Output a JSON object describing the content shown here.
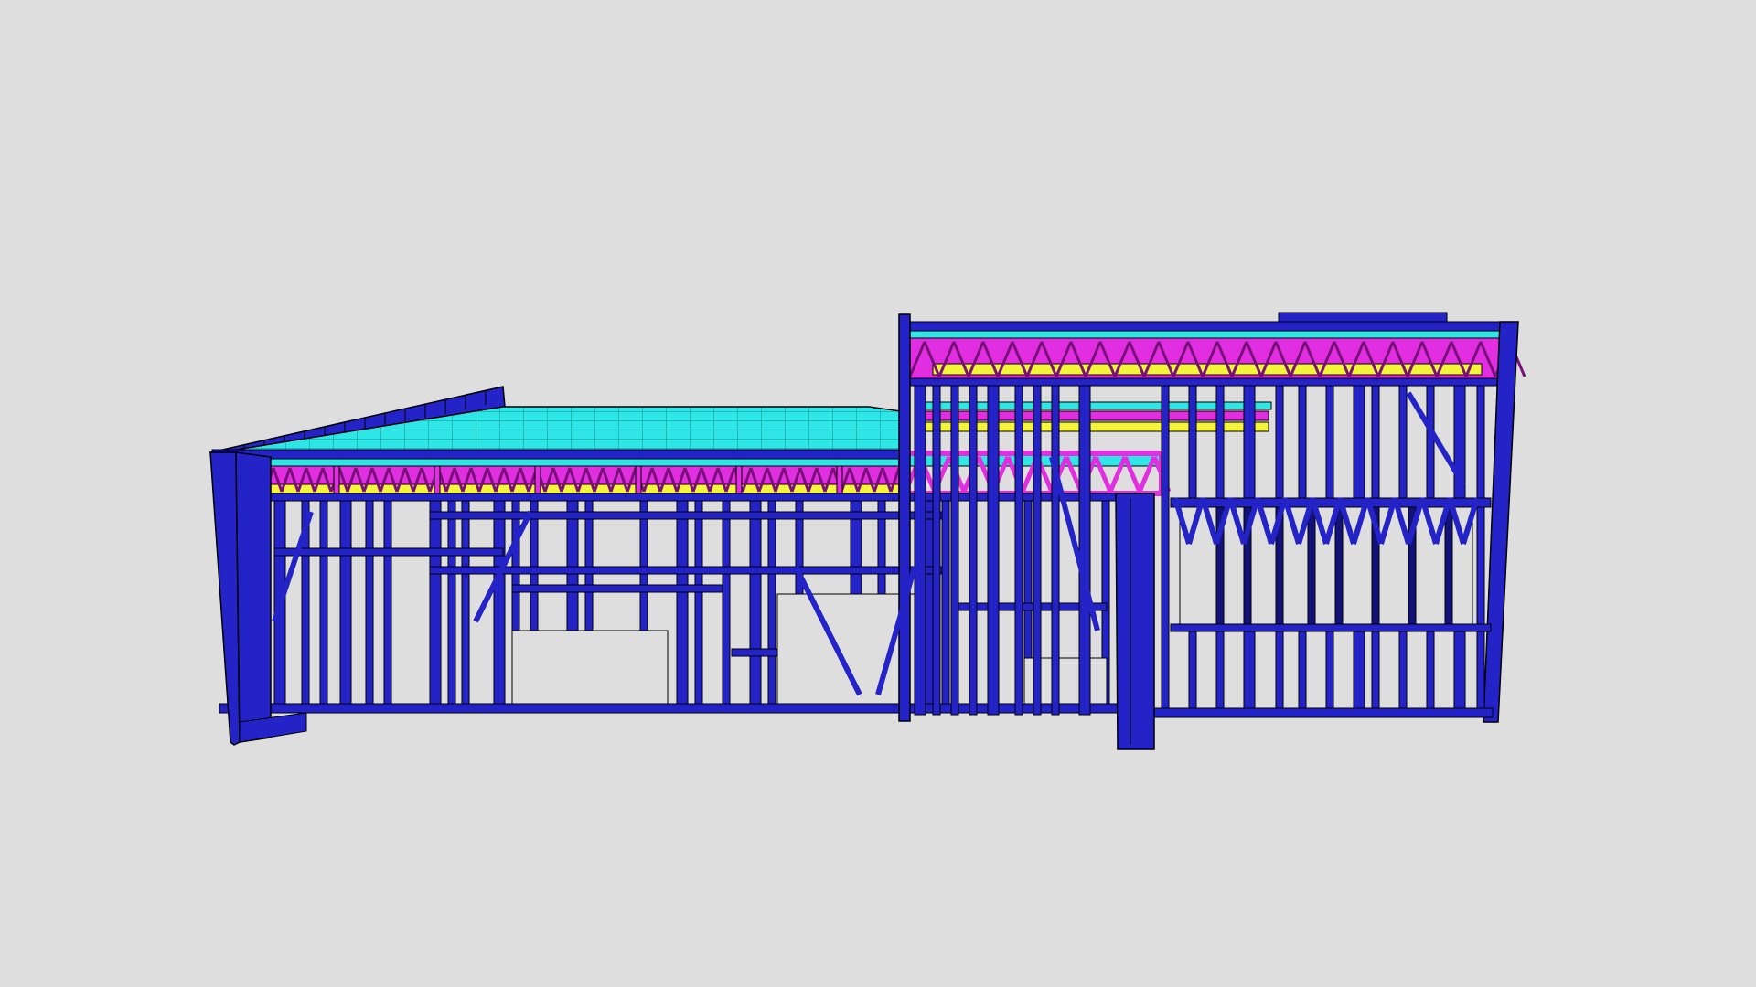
{
  "viewer": {
    "background_color": "#dedede"
  },
  "model": {
    "description_visible": false,
    "colors": {
      "wall_frame": "#2323c8",
      "wall_frame_dark": "#12127a",
      "floor_deck": "#2ee6e6",
      "floor_truss": "#e02ee0",
      "joist_band": "#f4f43a",
      "outline": "#000000"
    }
  }
}
